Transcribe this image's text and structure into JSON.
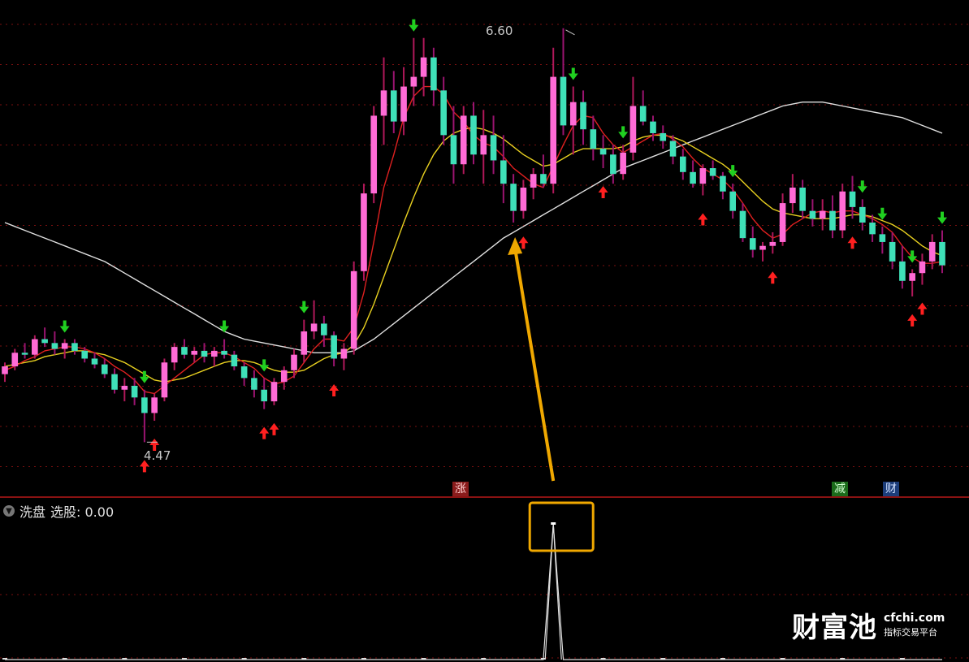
{
  "annotations": {
    "high_label": "6.60",
    "low_label": "4.47"
  },
  "tags": {
    "zhang": "涨",
    "jian": "减",
    "cai": "财"
  },
  "indicator": {
    "name": "洗盘",
    "select_label": "选股: 0.00"
  },
  "watermark": {
    "brand": "财富池",
    "url": "cfchi.com",
    "subtitle": "指标交易平台"
  },
  "colors": {
    "up": "#ff6bd6",
    "up_dark": "#b0185a",
    "down": "#3fe0b8",
    "down_dark": "#9a1470",
    "ma_short": "#e02020",
    "ma_mid": "#e8d020",
    "ma_long": "#e0e0e0",
    "buy_arrow": "#ff2020",
    "sell_arrow": "#20d020",
    "highlight": "#f0a800"
  },
  "chart_data": {
    "type": "candlestick",
    "title": "",
    "price_range": [
      4.3,
      6.62
    ],
    "high_value": 6.6,
    "low_value": 4.47,
    "candles": [
      [
        4.82,
        4.88,
        4.78,
        4.86
      ],
      [
        4.86,
        4.95,
        4.84,
        4.93
      ],
      [
        4.93,
        4.98,
        4.9,
        4.92
      ],
      [
        4.92,
        5.02,
        4.9,
        5.0
      ],
      [
        5.0,
        5.06,
        4.96,
        4.98
      ],
      [
        4.98,
        5.04,
        4.92,
        4.95
      ],
      [
        4.95,
        5.0,
        4.9,
        4.98
      ],
      [
        4.98,
        5.0,
        4.92,
        4.94
      ],
      [
        4.94,
        4.96,
        4.88,
        4.9
      ],
      [
        4.9,
        4.93,
        4.85,
        4.87
      ],
      [
        4.87,
        4.9,
        4.8,
        4.82
      ],
      [
        4.82,
        4.85,
        4.72,
        4.74
      ],
      [
        4.74,
        4.8,
        4.68,
        4.76
      ],
      [
        4.76,
        4.8,
        4.66,
        4.7
      ],
      [
        4.7,
        4.74,
        4.47,
        4.62
      ],
      [
        4.62,
        4.72,
        4.58,
        4.7
      ],
      [
        4.7,
        4.9,
        4.68,
        4.88
      ],
      [
        4.88,
        4.98,
        4.84,
        4.96
      ],
      [
        4.96,
        5.0,
        4.9,
        4.92
      ],
      [
        4.92,
        4.96,
        4.88,
        4.94
      ],
      [
        4.94,
        4.98,
        4.88,
        4.91
      ],
      [
        4.91,
        4.96,
        4.86,
        4.94
      ],
      [
        4.94,
        5.0,
        4.9,
        4.92
      ],
      [
        4.92,
        4.94,
        4.84,
        4.86
      ],
      [
        4.86,
        4.88,
        4.76,
        4.8
      ],
      [
        4.8,
        4.84,
        4.7,
        4.74
      ],
      [
        4.74,
        4.8,
        4.64,
        4.68
      ],
      [
        4.68,
        4.8,
        4.66,
        4.78
      ],
      [
        4.78,
        4.86,
        4.74,
        4.84
      ],
      [
        4.84,
        4.95,
        4.8,
        4.92
      ],
      [
        4.92,
        5.1,
        4.88,
        5.04
      ],
      [
        5.04,
        5.2,
        5.0,
        5.08
      ],
      [
        5.08,
        5.12,
        4.96,
        5.02
      ],
      [
        5.02,
        5.04,
        4.86,
        4.9
      ],
      [
        4.9,
        4.98,
        4.84,
        4.95
      ],
      [
        4.95,
        5.4,
        4.92,
        5.35
      ],
      [
        5.35,
        5.8,
        5.3,
        5.75
      ],
      [
        5.75,
        6.2,
        5.7,
        6.15
      ],
      [
        6.15,
        6.45,
        6.0,
        6.28
      ],
      [
        6.28,
        6.38,
        6.06,
        6.12
      ],
      [
        6.12,
        6.4,
        6.05,
        6.3
      ],
      [
        6.3,
        6.55,
        6.2,
        6.35
      ],
      [
        6.35,
        6.55,
        6.25,
        6.45
      ],
      [
        6.45,
        6.5,
        6.2,
        6.28
      ],
      [
        6.28,
        6.35,
        6.0,
        6.05
      ],
      [
        6.05,
        6.2,
        5.8,
        5.9
      ],
      [
        5.9,
        6.2,
        5.85,
        6.15
      ],
      [
        6.15,
        6.22,
        5.9,
        5.95
      ],
      [
        5.95,
        6.18,
        5.8,
        6.05
      ],
      [
        6.05,
        6.15,
        5.85,
        5.92
      ],
      [
        5.92,
        6.05,
        5.7,
        5.8
      ],
      [
        5.8,
        5.85,
        5.6,
        5.66
      ],
      [
        5.66,
        5.82,
        5.62,
        5.78
      ],
      [
        5.78,
        5.88,
        5.72,
        5.85
      ],
      [
        5.85,
        5.95,
        5.78,
        5.8
      ],
      [
        5.8,
        6.5,
        5.75,
        6.35
      ],
      [
        6.35,
        6.6,
        6.05,
        6.1
      ],
      [
        6.1,
        6.3,
        5.95,
        6.22
      ],
      [
        6.22,
        6.28,
        6.0,
        6.08
      ],
      [
        6.08,
        6.15,
        5.92,
        5.98
      ],
      [
        5.98,
        6.05,
        5.88,
        5.95
      ],
      [
        5.95,
        6.0,
        5.8,
        5.85
      ],
      [
        5.85,
        6.0,
        5.82,
        5.96
      ],
      [
        5.96,
        6.35,
        5.92,
        6.2
      ],
      [
        6.2,
        6.28,
        6.1,
        6.12
      ],
      [
        6.12,
        6.15,
        6.02,
        6.06
      ],
      [
        6.06,
        6.1,
        5.98,
        6.02
      ],
      [
        6.02,
        6.05,
        5.9,
        5.94
      ],
      [
        5.94,
        5.98,
        5.82,
        5.86
      ],
      [
        5.86,
        5.92,
        5.78,
        5.8
      ],
      [
        5.8,
        5.9,
        5.74,
        5.88
      ],
      [
        5.88,
        5.92,
        5.82,
        5.84
      ],
      [
        5.84,
        5.86,
        5.72,
        5.76
      ],
      [
        5.76,
        5.8,
        5.62,
        5.66
      ],
      [
        5.66,
        5.7,
        5.5,
        5.52
      ],
      [
        5.52,
        5.58,
        5.42,
        5.46
      ],
      [
        5.46,
        5.5,
        5.4,
        5.48
      ],
      [
        5.48,
        5.55,
        5.44,
        5.5
      ],
      [
        5.5,
        5.75,
        5.48,
        5.7
      ],
      [
        5.7,
        5.85,
        5.65,
        5.78
      ],
      [
        5.78,
        5.82,
        5.62,
        5.66
      ],
      [
        5.66,
        5.72,
        5.58,
        5.62
      ],
      [
        5.62,
        5.72,
        5.56,
        5.66
      ],
      [
        5.66,
        5.74,
        5.52,
        5.56
      ],
      [
        5.56,
        5.8,
        5.52,
        5.76
      ],
      [
        5.76,
        5.84,
        5.62,
        5.68
      ],
      [
        5.68,
        5.72,
        5.56,
        5.6
      ],
      [
        5.6,
        5.64,
        5.5,
        5.54
      ],
      [
        5.54,
        5.58,
        5.44,
        5.5
      ],
      [
        5.5,
        5.55,
        5.36,
        5.4
      ],
      [
        5.4,
        5.48,
        5.26,
        5.3
      ],
      [
        5.3,
        5.36,
        5.22,
        5.34
      ],
      [
        5.34,
        5.44,
        5.28,
        5.4
      ],
      [
        5.4,
        5.54,
        5.36,
        5.5
      ],
      [
        5.5,
        5.56,
        5.34,
        5.38
      ]
    ],
    "ma_short": [
      4.84,
      4.86,
      4.89,
      4.91,
      4.94,
      4.95,
      4.96,
      4.96,
      4.95,
      4.93,
      4.9,
      4.86,
      4.83,
      4.79,
      4.73,
      4.72,
      4.76,
      4.8,
      4.84,
      4.88,
      4.92,
      4.93,
      4.93,
      4.91,
      4.88,
      4.85,
      4.8,
      4.77,
      4.78,
      4.81,
      4.88,
      4.95,
      5.0,
      5.0,
      4.99,
      5.06,
      5.24,
      5.5,
      5.78,
      5.95,
      6.14,
      6.25,
      6.3,
      6.3,
      6.26,
      6.17,
      6.12,
      6.05,
      6.01,
      5.99,
      5.94,
      5.88,
      5.84,
      5.8,
      5.78,
      5.89,
      6.0,
      6.1,
      6.15,
      6.14,
      6.06,
      6.0,
      5.96,
      5.99,
      6.02,
      6.05,
      6.06,
      6.03,
      5.99,
      5.93,
      5.88,
      5.85,
      5.82,
      5.77,
      5.7,
      5.62,
      5.56,
      5.52,
      5.54,
      5.59,
      5.62,
      5.65,
      5.66,
      5.65,
      5.66,
      5.66,
      5.64,
      5.62,
      5.59,
      5.55,
      5.48,
      5.42,
      5.39,
      5.39,
      5.4
    ],
    "ma_mid": [
      4.86,
      4.87,
      4.88,
      4.89,
      4.91,
      4.92,
      4.93,
      4.94,
      4.94,
      4.93,
      4.92,
      4.9,
      4.88,
      4.85,
      4.82,
      4.79,
      4.78,
      4.79,
      4.8,
      4.82,
      4.84,
      4.86,
      4.88,
      4.89,
      4.89,
      4.88,
      4.86,
      4.84,
      4.83,
      4.83,
      4.84,
      4.87,
      4.9,
      4.92,
      4.93,
      4.97,
      5.06,
      5.18,
      5.32,
      5.46,
      5.6,
      5.73,
      5.85,
      5.95,
      6.02,
      6.06,
      6.08,
      6.09,
      6.08,
      6.06,
      6.03,
      5.99,
      5.95,
      5.92,
      5.89,
      5.9,
      5.93,
      5.96,
      5.98,
      5.98,
      5.98,
      5.98,
      5.99,
      6.02,
      6.04,
      6.05,
      6.05,
      6.04,
      6.02,
      5.99,
      5.96,
      5.93,
      5.9,
      5.86,
      5.81,
      5.76,
      5.71,
      5.67,
      5.65,
      5.64,
      5.63,
      5.62,
      5.62,
      5.62,
      5.63,
      5.64,
      5.64,
      5.63,
      5.61,
      5.59,
      5.56,
      5.52,
      5.48,
      5.45,
      5.43
    ],
    "ma_long": [
      5.6,
      5.58,
      5.56,
      5.54,
      5.52,
      5.5,
      5.48,
      5.46,
      5.44,
      5.42,
      5.4,
      5.37,
      5.34,
      5.31,
      5.28,
      5.25,
      5.22,
      5.19,
      5.16,
      5.13,
      5.1,
      5.07,
      5.04,
      5.02,
      5.0,
      4.99,
      4.98,
      4.97,
      4.96,
      4.95,
      4.94,
      4.93,
      4.93,
      4.93,
      4.93,
      4.94,
      4.97,
      5.0,
      5.04,
      5.08,
      5.12,
      5.16,
      5.2,
      5.24,
      5.28,
      5.32,
      5.36,
      5.4,
      5.44,
      5.48,
      5.52,
      5.55,
      5.58,
      5.61,
      5.64,
      5.67,
      5.7,
      5.73,
      5.76,
      5.79,
      5.82,
      5.85,
      5.88,
      5.9,
      5.92,
      5.94,
      5.96,
      5.98,
      6.0,
      6.02,
      6.04,
      6.06,
      6.08,
      6.1,
      6.12,
      6.14,
      6.16,
      6.18,
      6.2,
      6.21,
      6.22,
      6.22,
      6.22,
      6.21,
      6.2,
      6.19,
      6.18,
      6.17,
      6.16,
      6.15,
      6.14,
      6.12,
      6.1,
      6.08,
      6.06
    ],
    "buy_signals": [
      14,
      15,
      26,
      27,
      33,
      52,
      60,
      70,
      77,
      85,
      91,
      92
    ],
    "sell_signals": [
      6,
      14,
      22,
      26,
      30,
      41,
      57,
      62,
      73,
      86,
      88,
      91,
      94
    ],
    "indicator_values": [
      0,
      0,
      0,
      0,
      0,
      0,
      0,
      0,
      0,
      0,
      0,
      0,
      0,
      0,
      0,
      0,
      0,
      0,
      0,
      0,
      0,
      0,
      0,
      0,
      0,
      0,
      0,
      0,
      0,
      0,
      0,
      0,
      0,
      0,
      0,
      0,
      0,
      0,
      0,
      0,
      0,
      0,
      0,
      0,
      0,
      0,
      0,
      0,
      0,
      0,
      0,
      0,
      0,
      0,
      0,
      1,
      0,
      0,
      0,
      0,
      0,
      0,
      0,
      0,
      0,
      0,
      0,
      0,
      0,
      0,
      0,
      0,
      0,
      0,
      0,
      0,
      0,
      0,
      0,
      0,
      0,
      0,
      0,
      0,
      0,
      0,
      0,
      0,
      0,
      0,
      0,
      0,
      0,
      0,
      0
    ]
  }
}
